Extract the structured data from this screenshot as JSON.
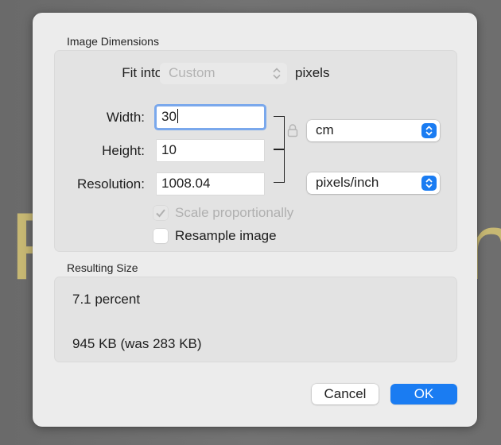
{
  "background": {
    "left_letter": "P",
    "right_letter": "n",
    "letter_color": "#c7b873"
  },
  "dialog": {
    "image_dimensions": {
      "title": "Image Dimensions",
      "fit_into": {
        "label": "Fit into:",
        "value": "Custom",
        "unit": "pixels",
        "enabled": false
      },
      "width": {
        "label": "Width:",
        "value": "30"
      },
      "height": {
        "label": "Height:",
        "value": "10"
      },
      "resolution": {
        "label": "Resolution:",
        "value": "1008.04"
      },
      "size_unit": {
        "value": "cm"
      },
      "resolution_unit": {
        "value": "pixels/inch"
      },
      "scale_proportionally": {
        "label": "Scale proportionally",
        "checked": true,
        "enabled": false
      },
      "resample_image": {
        "label": "Resample image",
        "checked": false,
        "enabled": true
      }
    },
    "resulting_size": {
      "title": "Resulting Size",
      "percent": "7.1 percent",
      "file_size": "945 KB (was 283 KB)"
    },
    "buttons": {
      "cancel": "Cancel",
      "ok": "OK"
    },
    "accent_color": "#1a7cf2"
  }
}
